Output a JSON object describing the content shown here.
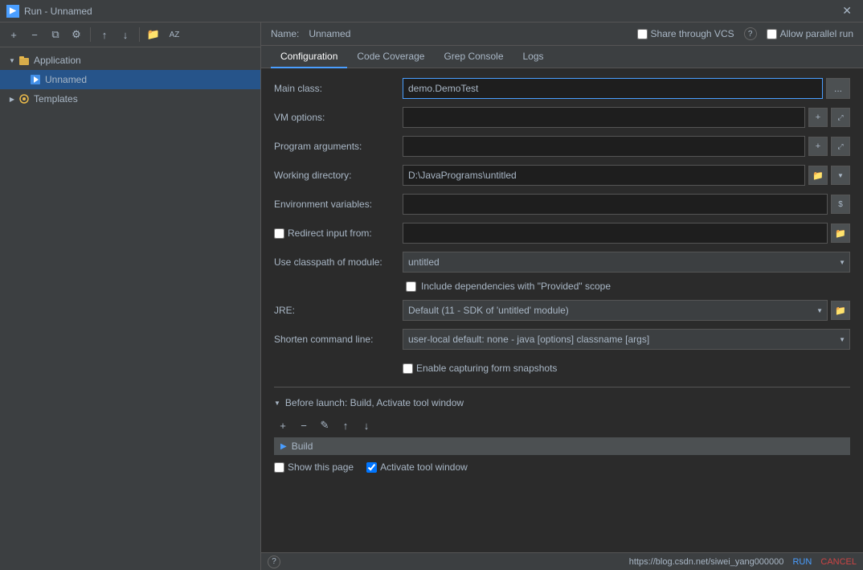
{
  "title_bar": {
    "title": "Run - Unnamed",
    "icon": "▶"
  },
  "left_panel": {
    "toolbar": {
      "add_btn": "+",
      "remove_btn": "−",
      "copy_btn": "⧉",
      "config_btn": "⚙",
      "up_btn": "↑",
      "down_btn": "↓",
      "folder_btn": "📁",
      "sort_btn": "AZ"
    },
    "tree": {
      "application_label": "Application",
      "unnamed_label": "Unnamed",
      "templates_label": "Templates"
    }
  },
  "right_panel": {
    "name_label": "Name:",
    "name_value": "Unnamed",
    "share_through_vcs_label": "Share through VCS",
    "question_mark": "?",
    "allow_parallel_run_label": "Allow parallel run"
  },
  "tabs": [
    {
      "label": "Configuration",
      "active": true
    },
    {
      "label": "Code Coverage",
      "active": false
    },
    {
      "label": "Grep Console",
      "active": false
    },
    {
      "label": "Logs",
      "active": false
    }
  ],
  "form": {
    "main_class_label": "Main class:",
    "main_class_value": "demo.DemoTest",
    "vm_options_label": "VM options:",
    "vm_options_value": "",
    "program_arguments_label": "Program arguments:",
    "program_arguments_value": "",
    "working_directory_label": "Working directory:",
    "working_directory_value": "D:\\JavaPrograms\\untitled",
    "env_variables_label": "Environment variables:",
    "env_variables_value": "",
    "redirect_input_label": "Redirect input from:",
    "redirect_input_value": "",
    "use_classpath_label": "Use classpath of module:",
    "use_classpath_value": "untitled",
    "include_dependencies_label": "Include dependencies with \"Provided\" scope",
    "jre_label": "JRE:",
    "jre_value": "Default (11 - SDK of 'untitled' module)",
    "shorten_cmd_label": "Shorten command line:",
    "shorten_cmd_value": "user-local default: none - java [options] classname [args]",
    "enable_capturing_label": "Enable capturing form snapshots"
  },
  "before_launch": {
    "header_label": "Before launch: Build, Activate tool window",
    "add_btn": "+",
    "remove_btn": "−",
    "edit_btn": "✎",
    "up_btn": "↑",
    "down_btn": "↓",
    "build_item": "Build",
    "show_page_label": "Show this page",
    "activate_tool_window_label": "Activate tool window"
  },
  "status_bar": {
    "help_icon": "?",
    "run_label": "RUN",
    "cancel_label": "CANCEL",
    "url": "https://blog.csdn.net/siwei_yang000000"
  }
}
